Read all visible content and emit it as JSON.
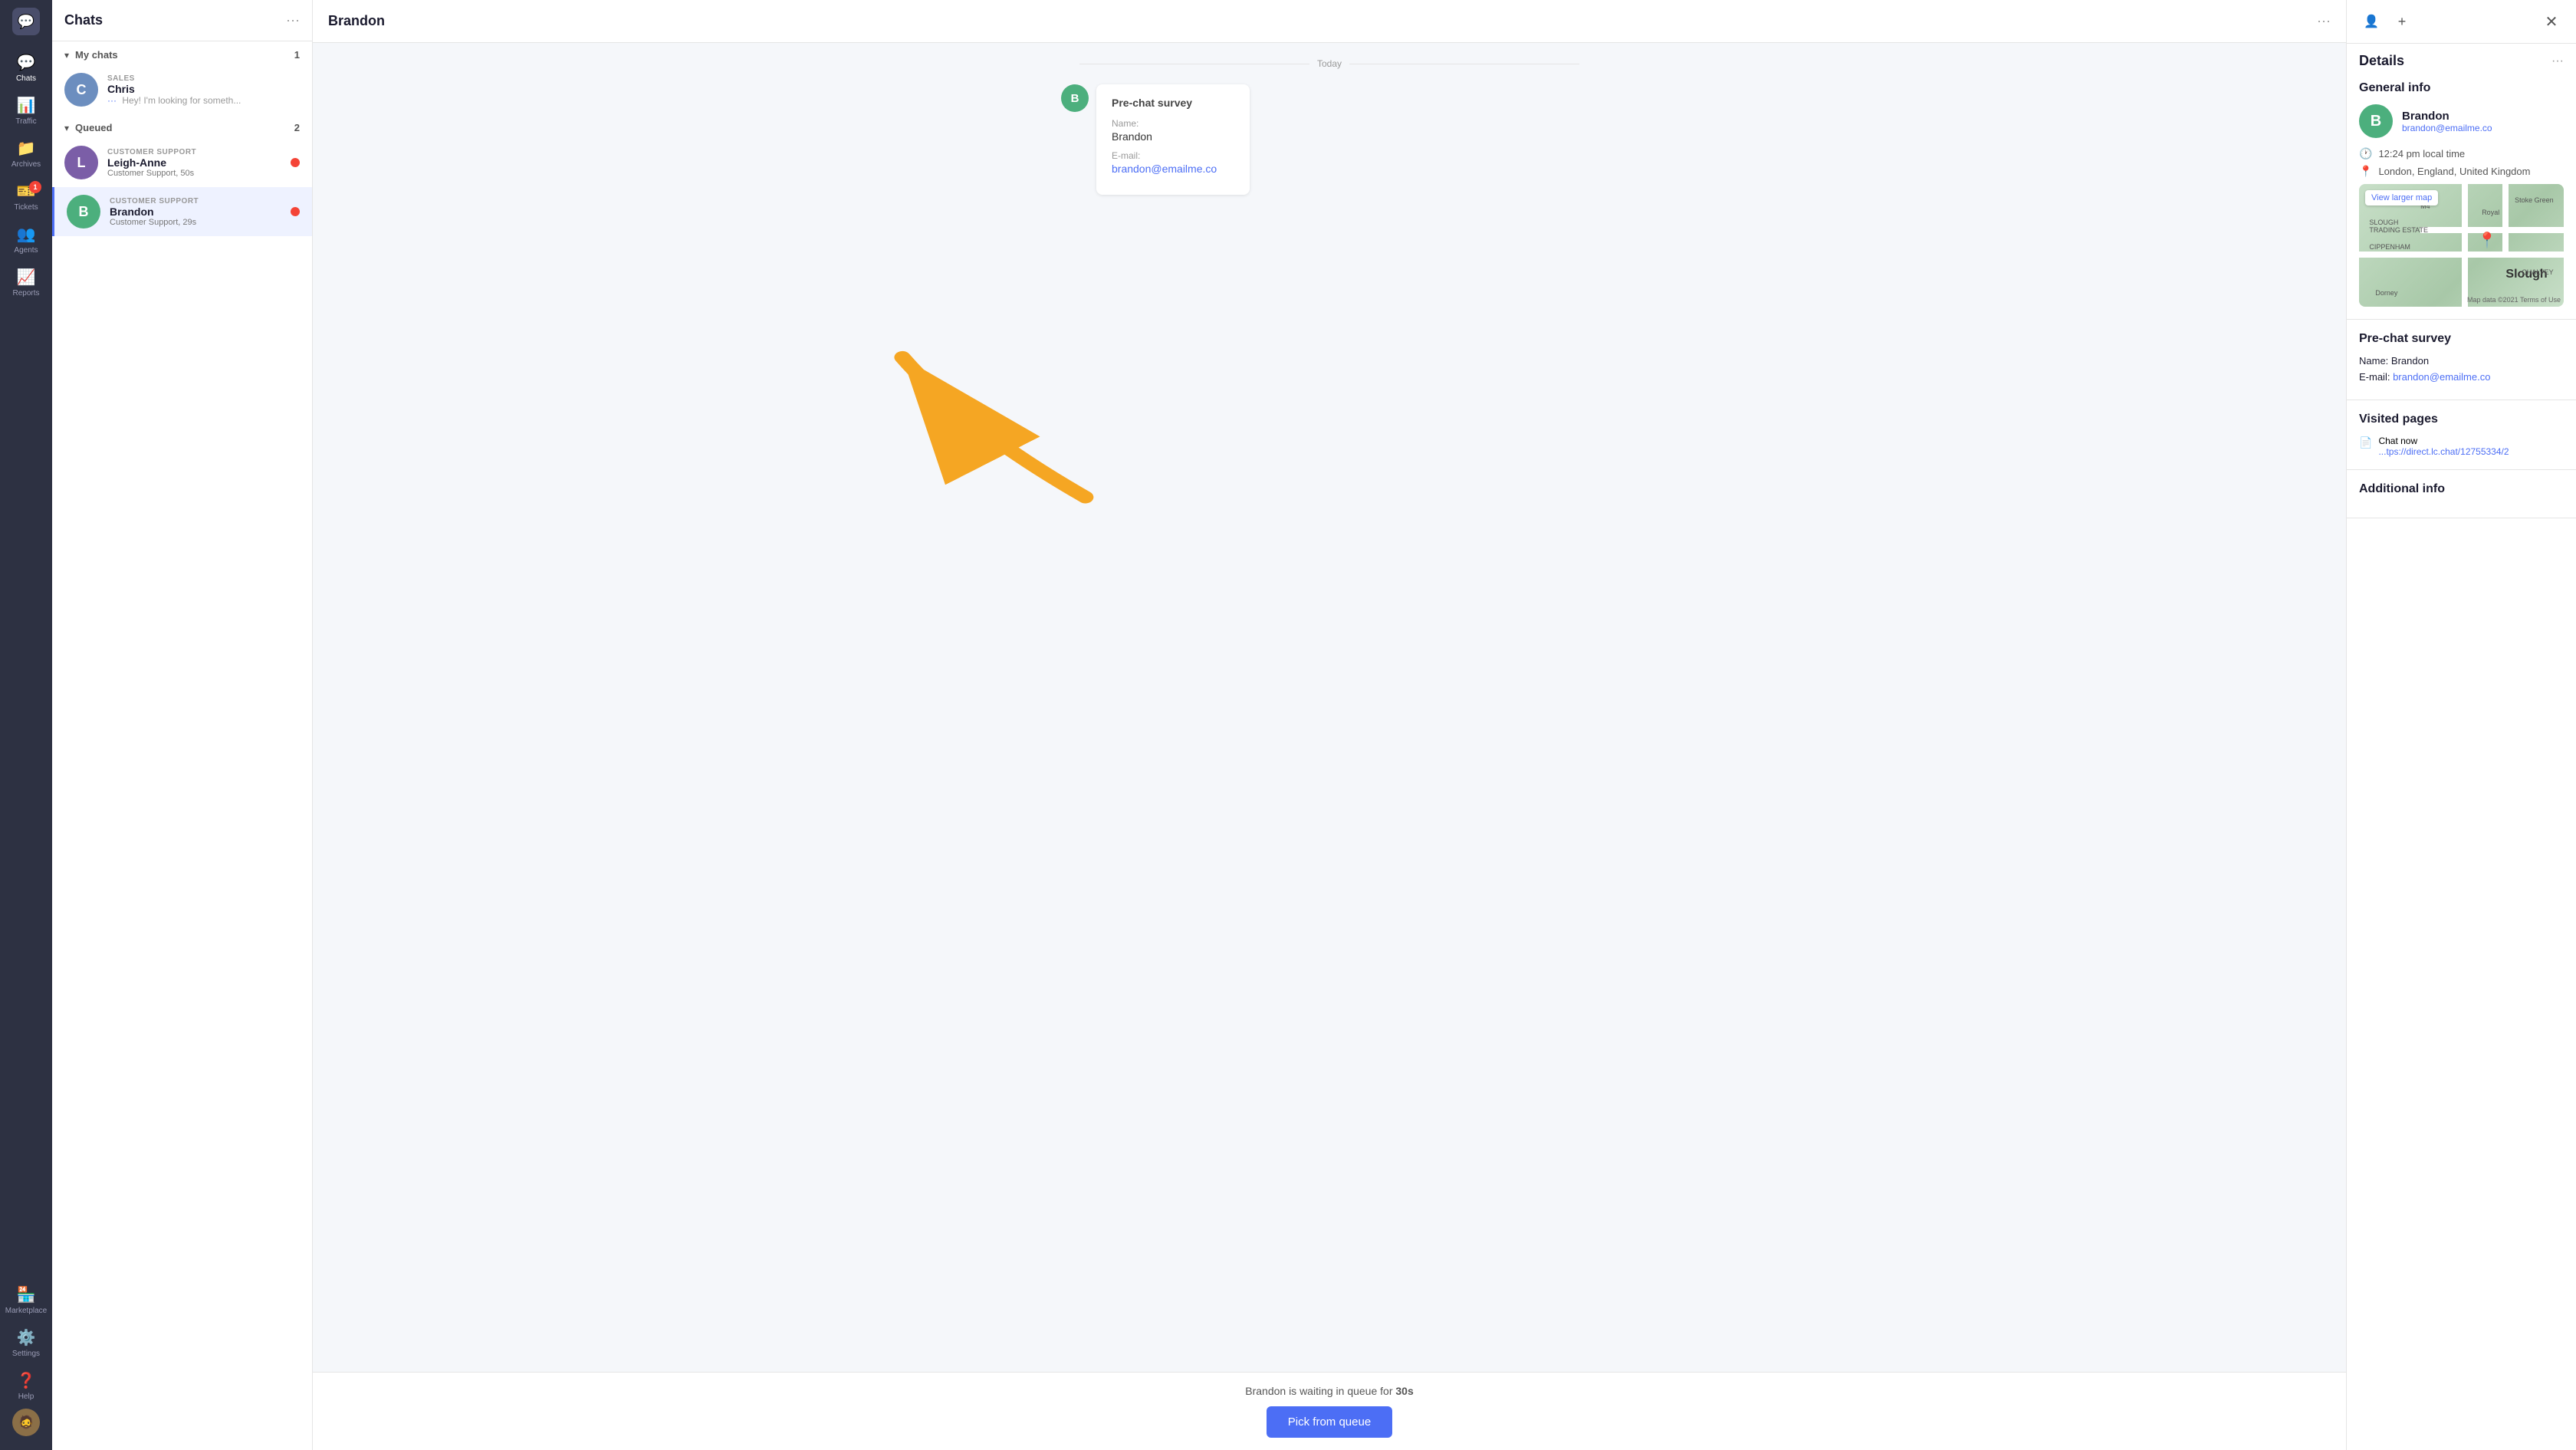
{
  "nav": {
    "logo_icon": "💬",
    "items": [
      {
        "id": "chats",
        "icon": "💬",
        "label": "Chats",
        "active": true,
        "badge": null
      },
      {
        "id": "traffic",
        "icon": "📊",
        "label": "Traffic",
        "active": false,
        "badge": null
      },
      {
        "id": "archives",
        "icon": "📁",
        "label": "Archives",
        "active": false,
        "badge": null
      },
      {
        "id": "tickets",
        "icon": "🎫",
        "label": "Tickets",
        "active": false,
        "badge": "1"
      },
      {
        "id": "agents",
        "icon": "👥",
        "label": "Agents",
        "active": false,
        "badge": null
      },
      {
        "id": "reports",
        "icon": "📈",
        "label": "Reports",
        "active": false,
        "badge": null
      },
      {
        "id": "marketplace",
        "icon": "🏪",
        "label": "Marketplace",
        "active": false,
        "badge": null
      },
      {
        "id": "settings",
        "icon": "⚙️",
        "label": "Settings",
        "active": false,
        "badge": null
      },
      {
        "id": "help",
        "icon": "❓",
        "label": "Help",
        "active": false,
        "badge": null
      }
    ],
    "avatar_icon": "🧔"
  },
  "chat_list": {
    "panel_title": "Chats",
    "panel_menu_icon": "•••",
    "sections": [
      {
        "id": "my_chats",
        "title": "My chats",
        "count": "1",
        "expanded": true,
        "items": [
          {
            "id": "chris",
            "category": "SALES",
            "name": "Chris",
            "preview": "Hey! I'm looking for someth...",
            "avatar_letter": "C",
            "avatar_class": "avatar-c",
            "has_status_dot": false,
            "is_typing": true
          }
        ]
      },
      {
        "id": "queued",
        "title": "Queued",
        "count": "2",
        "expanded": true,
        "items": [
          {
            "id": "leigh_anne",
            "category": "CUSTOMER SUPPORT",
            "name": "Leigh-Anne",
            "preview": "Customer Support, 50s",
            "avatar_letter": "L",
            "avatar_class": "avatar-l",
            "has_status_dot": true,
            "is_typing": false
          },
          {
            "id": "brandon",
            "category": "CUSTOMER SUPPORT",
            "name": "Brandon",
            "preview": "Customer Support, 29s",
            "avatar_letter": "B",
            "avatar_class": "avatar-b",
            "has_status_dot": true,
            "is_typing": false,
            "active": true
          }
        ]
      }
    ]
  },
  "main_chat": {
    "header_name": "Brandon",
    "header_menu_icon": "•••",
    "date_label": "Today",
    "survey_card": {
      "title": "Pre-chat survey",
      "name_label": "Name:",
      "name_value": "Brandon",
      "email_label": "E-mail:",
      "email_value": "brandon@emailme.co"
    },
    "avatar_letter": "B",
    "footer": {
      "waiting_text_prefix": "Brandon is waiting in queue for",
      "waiting_time": "30s",
      "button_label": "Pick from queue"
    }
  },
  "right_panel": {
    "title": "Details",
    "menu_icon": "•••",
    "close_icon": "✕",
    "add_person_icon": "+",
    "general_info": {
      "title": "General info",
      "name": "Brandon",
      "email": "brandon@emailme.co",
      "avatar_letter": "B",
      "local_time": "12:24 pm local time",
      "location": "London, England, United Kingdom",
      "map_view_label": "View larger map",
      "map_credit": "Map data ©2021  Terms of Use"
    },
    "pre_chat_survey": {
      "title": "Pre-chat survey",
      "name_label": "Name:",
      "name_value": "Brandon",
      "email_label": "E-mail:",
      "email_value": "brandon@emailme.co"
    },
    "visited_pages": {
      "title": "Visited pages",
      "items": [
        {
          "icon": "📄",
          "label": "Chat now",
          "link": "...tps://direct.lc.chat/12755334/2"
        }
      ]
    },
    "additional_info": {
      "title": "Additional info"
    }
  }
}
